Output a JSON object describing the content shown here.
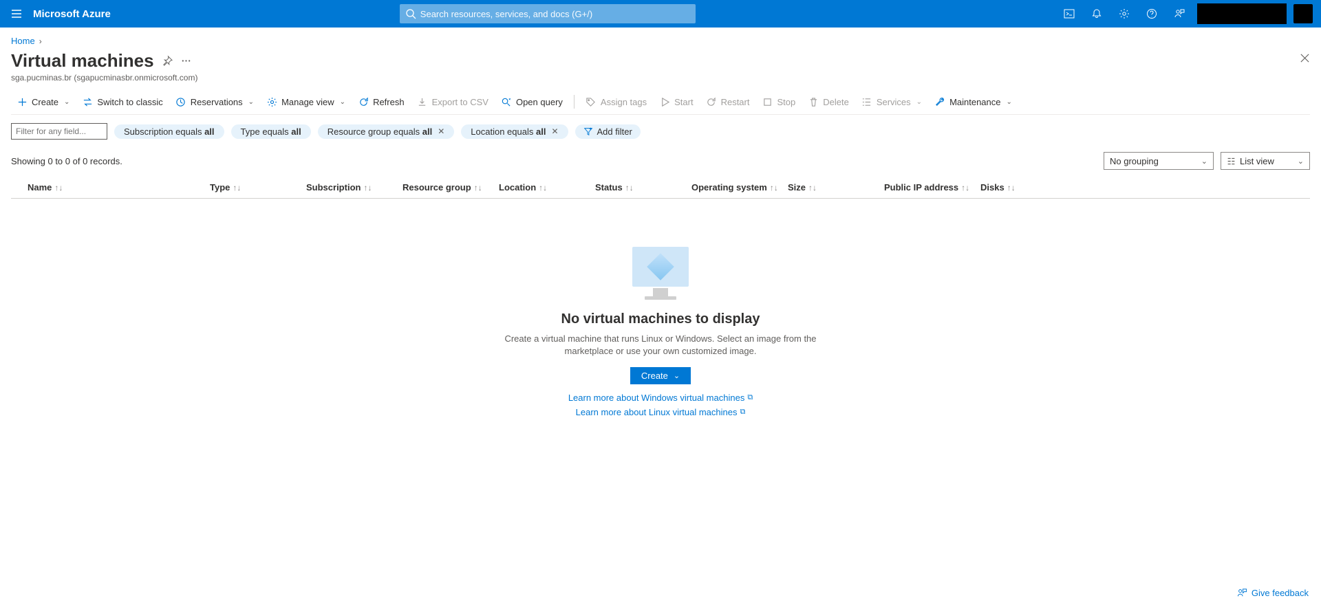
{
  "header": {
    "brand": "Microsoft Azure",
    "search_placeholder": "Search resources, services, and docs (G+/)"
  },
  "breadcrumb": {
    "home": "Home"
  },
  "page": {
    "title": "Virtual machines",
    "subtitle": "sga.pucminas.br (sgapucminasbr.onmicrosoft.com)"
  },
  "commands": {
    "create": "Create",
    "switch_classic": "Switch to classic",
    "reservations": "Reservations",
    "manage_view": "Manage view",
    "refresh": "Refresh",
    "export_csv": "Export to CSV",
    "open_query": "Open query",
    "assign_tags": "Assign tags",
    "start": "Start",
    "restart": "Restart",
    "stop": "Stop",
    "delete": "Delete",
    "services": "Services",
    "maintenance": "Maintenance"
  },
  "filters": {
    "input_placeholder": "Filter for any field...",
    "subscription_prefix": "Subscription equals ",
    "subscription_value": "all",
    "type_prefix": "Type equals ",
    "type_value": "all",
    "rg_prefix": "Resource group equals ",
    "rg_value": "all",
    "location_prefix": "Location equals ",
    "location_value": "all",
    "add_filter": "Add filter"
  },
  "status": {
    "showing": "Showing 0 to 0 of 0 records.",
    "grouping": "No grouping",
    "view": "List view"
  },
  "columns": {
    "name": "Name",
    "type": "Type",
    "subscription": "Subscription",
    "resource_group": "Resource group",
    "location": "Location",
    "status": "Status",
    "os": "Operating system",
    "size": "Size",
    "public_ip": "Public IP address",
    "disks": "Disks"
  },
  "empty_state": {
    "title": "No virtual machines to display",
    "body": "Create a virtual machine that runs Linux or Windows. Select an image from the marketplace or use your own customized image.",
    "create": "Create",
    "link_windows": "Learn more about Windows virtual machines",
    "link_linux": "Learn more about Linux virtual machines"
  },
  "feedback": "Give feedback"
}
